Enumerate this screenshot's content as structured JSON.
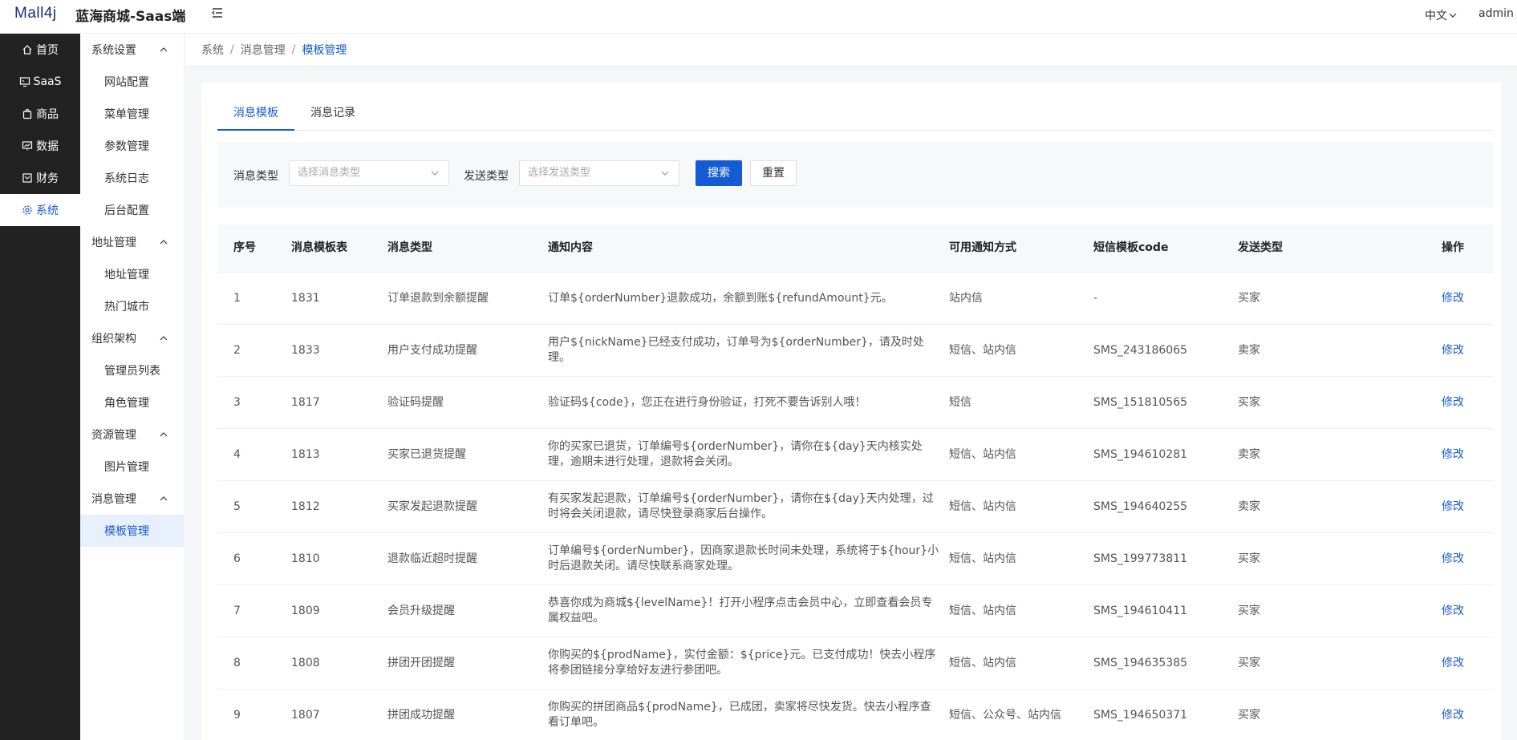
{
  "header": {
    "logo_text": "Mall4j",
    "app_name": "蓝海商城-Saas端",
    "language": "中文",
    "username": "admin"
  },
  "primary_nav": [
    {
      "label": "首页",
      "icon": "home-icon"
    },
    {
      "label": "SaaS",
      "icon": "monitor-icon"
    },
    {
      "label": "商品",
      "icon": "bag-icon"
    },
    {
      "label": "数据",
      "icon": "chart-icon"
    },
    {
      "label": "财务",
      "icon": "finance-icon"
    },
    {
      "label": "系统",
      "icon": "gear-icon",
      "active": true
    }
  ],
  "secondary_nav": [
    {
      "title": "系统设置",
      "items": [
        "网站配置",
        "菜单管理",
        "参数管理",
        "系统日志",
        "后台配置"
      ]
    },
    {
      "title": "地址管理",
      "items": [
        "地址管理",
        "热门城市"
      ]
    },
    {
      "title": "组织架构",
      "items": [
        "管理员列表",
        "角色管理"
      ]
    },
    {
      "title": "资源管理",
      "items": [
        "图片管理"
      ]
    },
    {
      "title": "消息管理",
      "items": [
        "模板管理"
      ]
    }
  ],
  "breadcrumb": [
    "系统",
    "消息管理",
    "模板管理"
  ],
  "tabs": [
    "消息模板",
    "消息记录"
  ],
  "search": {
    "msg_type_label": "消息类型",
    "msg_type_placeholder": "选择消息类型",
    "send_type_label": "发送类型",
    "send_type_placeholder": "选择发送类型",
    "search_button": "搜索",
    "reset_button": "重置"
  },
  "table": {
    "columns": [
      "序号",
      "消息模板表",
      "消息类型",
      "通知内容",
      "可用通知方式",
      "短信模板code",
      "发送类型",
      "操作"
    ],
    "rows": [
      {
        "idx": "1",
        "id": "1831",
        "type": "订单退款到余额提醒",
        "content": "订单${orderNumber}退款成功，余额到账${refundAmount}元。",
        "method": "站内信",
        "code": "-",
        "send": "买家",
        "op": "修改"
      },
      {
        "idx": "2",
        "id": "1833",
        "type": "用户支付成功提醒",
        "content": "用户${nickName}已经支付成功，订单号为${orderNumber}，请及时处理。",
        "method": "短信、站内信",
        "code": "SMS_243186065",
        "send": "卖家",
        "op": "修改"
      },
      {
        "idx": "3",
        "id": "1817",
        "type": "验证码提醒",
        "content": "验证码${code}，您正在进行身份验证，打死不要告诉别人哦！",
        "method": "短信",
        "code": "SMS_151810565",
        "send": "买家",
        "op": "修改"
      },
      {
        "idx": "4",
        "id": "1813",
        "type": "买家已退货提醒",
        "content": "你的买家已退货，订单编号${orderNumber}，请你在${day}天内核实处理，逾期未进行处理，退款将会关闭。",
        "method": "短信、站内信",
        "code": "SMS_194610281",
        "send": "卖家",
        "op": "修改"
      },
      {
        "idx": "5",
        "id": "1812",
        "type": "买家发起退款提醒",
        "content": "有买家发起退款，订单编号${orderNumber}，请你在${day}天内处理，过时将会关闭退款，请尽快登录商家后台操作。",
        "method": "短信、站内信",
        "code": "SMS_194640255",
        "send": "卖家",
        "op": "修改"
      },
      {
        "idx": "6",
        "id": "1810",
        "type": "退款临近超时提醒",
        "content": "订单编号${orderNumber}，因商家退款长时间未处理，系统将于${hour}小时后退款关闭。请尽快联系商家处理。",
        "method": "短信、站内信",
        "code": "SMS_199773811",
        "send": "买家",
        "op": "修改"
      },
      {
        "idx": "7",
        "id": "1809",
        "type": "会员升级提醒",
        "content": "恭喜你成为商城${levelName}！打开小程序点击会员中心，立即查看会员专属权益吧。",
        "method": "短信、站内信",
        "code": "SMS_194610411",
        "send": "买家",
        "op": "修改"
      },
      {
        "idx": "8",
        "id": "1808",
        "type": "拼团开团提醒",
        "content": "你购买的${prodName}，实付金额：${price}元。已支付成功！快去小程序将参团链接分享给好友进行参团吧。",
        "method": "短信、站内信",
        "code": "SMS_194635385",
        "send": "买家",
        "op": "修改"
      },
      {
        "idx": "9",
        "id": "1807",
        "type": "拼团成功提醒",
        "content": "你购买的拼团商品${prodName}，已成团，卖家将尽快发货。快去小程序查看订单吧。",
        "method": "短信、公众号、站内信",
        "code": "SMS_194650371",
        "send": "买家",
        "op": "修改"
      }
    ]
  }
}
